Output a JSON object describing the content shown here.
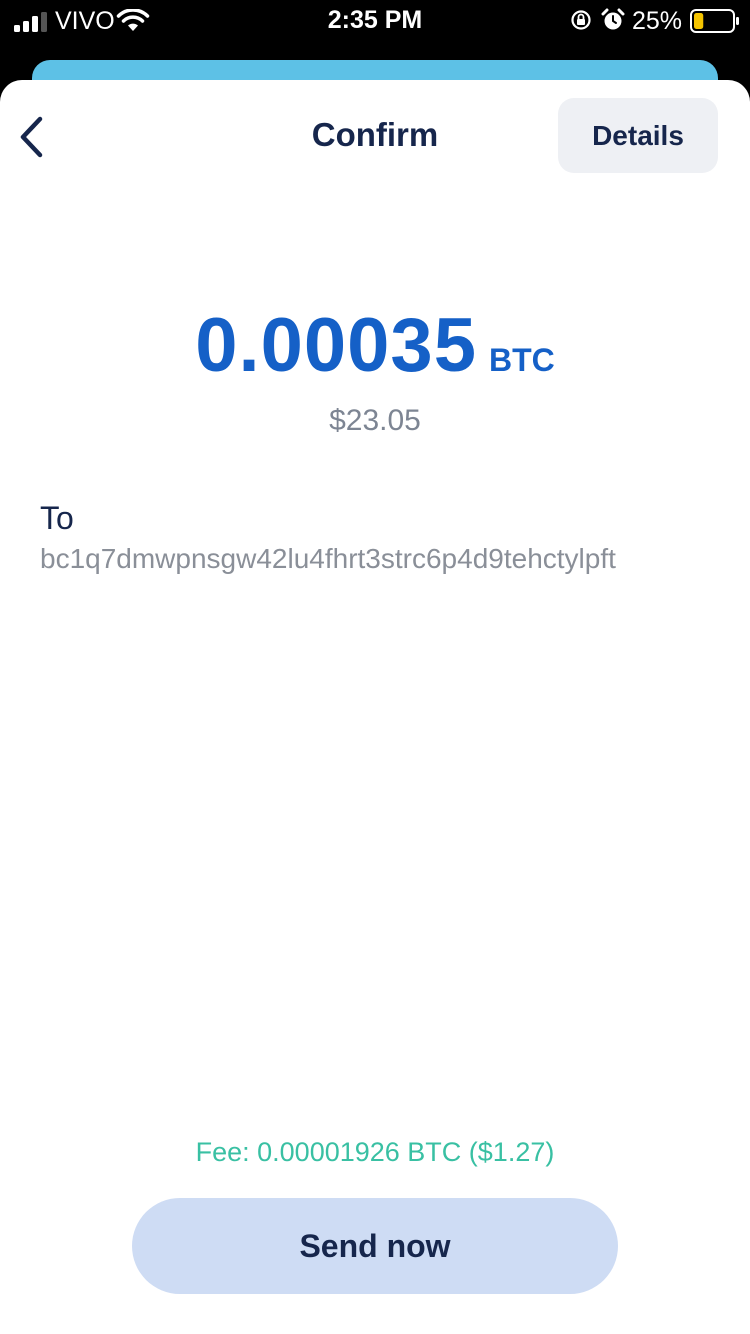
{
  "status_bar": {
    "carrier": "VIVO",
    "time": "2:35 PM",
    "battery_percent": "25%",
    "battery_level": 0.25,
    "signal_bars": 3,
    "icons": [
      "signal-icon",
      "wifi-icon",
      "orientation-lock-icon",
      "alarm-icon",
      "battery-icon"
    ]
  },
  "header": {
    "title": "Confirm",
    "details_label": "Details",
    "back_icon": "chevron-left-icon"
  },
  "amount": {
    "value": "0.00035",
    "unit": "BTC",
    "fiat": "$23.05"
  },
  "recipient": {
    "label": "To",
    "address": "bc1q7dmwpnsgw42lu4fhrt3strc6p4d9tehctylpft"
  },
  "footer": {
    "fee": "Fee: 0.00001926 BTC ($1.27)",
    "send_label": "Send now"
  },
  "colors": {
    "accent": "#1560c7",
    "title": "#16264c",
    "fee": "#39c0a3",
    "send_button": "#cedcf4",
    "sheet_behind": "#5dc1e6",
    "battery_fill": "#f5c400"
  }
}
